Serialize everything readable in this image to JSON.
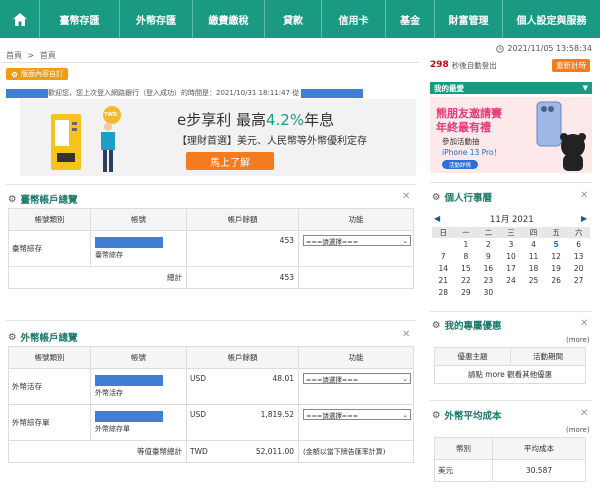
{
  "nav": {
    "items": [
      "臺幣存匯",
      "外幣存匯",
      "繳費繳稅",
      "貸款",
      "信用卡",
      "基金",
      "財富管理",
      "個人設定與服務"
    ]
  },
  "breadcrumb": {
    "home": "首頁",
    "sep": ">",
    "current": "首頁"
  },
  "datetime": "2021/11/05 13:58:34",
  "custom_btn": "版面內容自訂",
  "logout": {
    "seconds": "298",
    "text": "秒後自動登出",
    "recount": "重新計時"
  },
  "welcome": {
    "text": "歡迎您，您上次登入網路銀行（登入成功）的時間是：2021/10/31 18:11:47 從"
  },
  "banner": {
    "title_prefix": "e步享利 最高",
    "title_rate": "4.2%",
    "title_suffix": "年息",
    "subtitle": "【理財首選】美元、人民幣等外幣優利定存",
    "button": "馬上了解",
    "coin": "TWD"
  },
  "promo": {
    "header": "我的最愛",
    "line1": "熊朋友邀請賽",
    "line2": "年終最有禮",
    "line3": "參加活動抽",
    "line4": "iPhone 13 Pro！",
    "button": "活動詳情"
  },
  "twd_panel": {
    "title": "臺幣帳戶總覽",
    "headers": [
      "帳號類別",
      "帳號",
      "帳戶餘額",
      "功能"
    ],
    "rows": [
      {
        "type": "臺幣綜存",
        "acct_name": "臺幣綜存",
        "balance": "453",
        "select": "===請選擇==="
      }
    ],
    "total_label": "總計",
    "total": "453"
  },
  "fx_panel": {
    "title": "外幣帳戶總覽",
    "headers": [
      "帳號類別",
      "帳號",
      "帳戶餘額",
      "功能"
    ],
    "rows": [
      {
        "type": "外幣活存",
        "acct_name": "外幣活存",
        "ccy": "USD",
        "balance": "48.01",
        "select": "===請選擇==="
      },
      {
        "type": "外幣綜存單",
        "acct_name": "外幣綜存單",
        "ccy": "USD",
        "balance": "1,819.52",
        "select": "===請選擇==="
      }
    ],
    "total_label": "等值臺幣總計",
    "total_ccy": "TWD",
    "total": "52,011.00",
    "note": "(金額以當下牌告匯率計算)"
  },
  "calendar": {
    "title": "個人行事曆",
    "month": "11月 2021",
    "prev": "◀",
    "next": "▶",
    "weekdays": [
      "日",
      "一",
      "二",
      "三",
      "四",
      "五",
      "六"
    ],
    "weeks": [
      [
        "",
        "1",
        "2",
        "3",
        "4",
        "5",
        "6"
      ],
      [
        "7",
        "8",
        "9",
        "10",
        "11",
        "12",
        "13"
      ],
      [
        "14",
        "15",
        "16",
        "17",
        "18",
        "19",
        "20"
      ],
      [
        "21",
        "22",
        "23",
        "24",
        "25",
        "26",
        "27"
      ],
      [
        "28",
        "29",
        "30",
        "",
        "",
        "",
        ""
      ]
    ],
    "today": "5"
  },
  "offers": {
    "title": "我的專屬優惠",
    "more": "(more)",
    "headers": [
      "優惠主題",
      "活動期間"
    ],
    "hint": "請點 more 觀看其他優惠"
  },
  "fxcost": {
    "title": "外幣平均成本",
    "more": "(more)",
    "headers": [
      "幣別",
      "平均成本"
    ],
    "rows": [
      {
        "ccy": "美元",
        "cost": "30.587"
      }
    ]
  },
  "icons": {
    "home": "home-icon",
    "gear": "gear-icon",
    "close": "close-icon",
    "clock": "clock-icon"
  },
  "colors": {
    "nav": "#1a9a83",
    "accent": "#f47b20",
    "mask": "#3f7fd6"
  }
}
